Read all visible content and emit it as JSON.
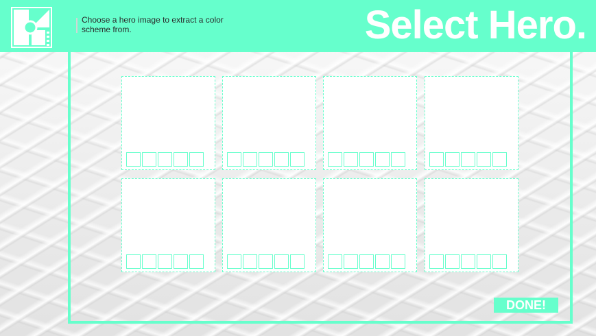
{
  "header": {
    "instructions": "Choose a hero image to extract a color scheme from.",
    "title": "Select Hero."
  },
  "logo": {
    "icon": "brand-logo-icon"
  },
  "colors": {
    "accent": "#66ffcc",
    "card": "#ffffff",
    "title_text": "#ffffff"
  },
  "hero_slots": [
    {
      "swatches": 5
    },
    {
      "swatches": 5
    },
    {
      "swatches": 5
    },
    {
      "swatches": 5
    },
    {
      "swatches": 5
    },
    {
      "swatches": 5
    },
    {
      "swatches": 5
    },
    {
      "swatches": 5
    }
  ],
  "actions": {
    "done_label": "DONE!"
  }
}
